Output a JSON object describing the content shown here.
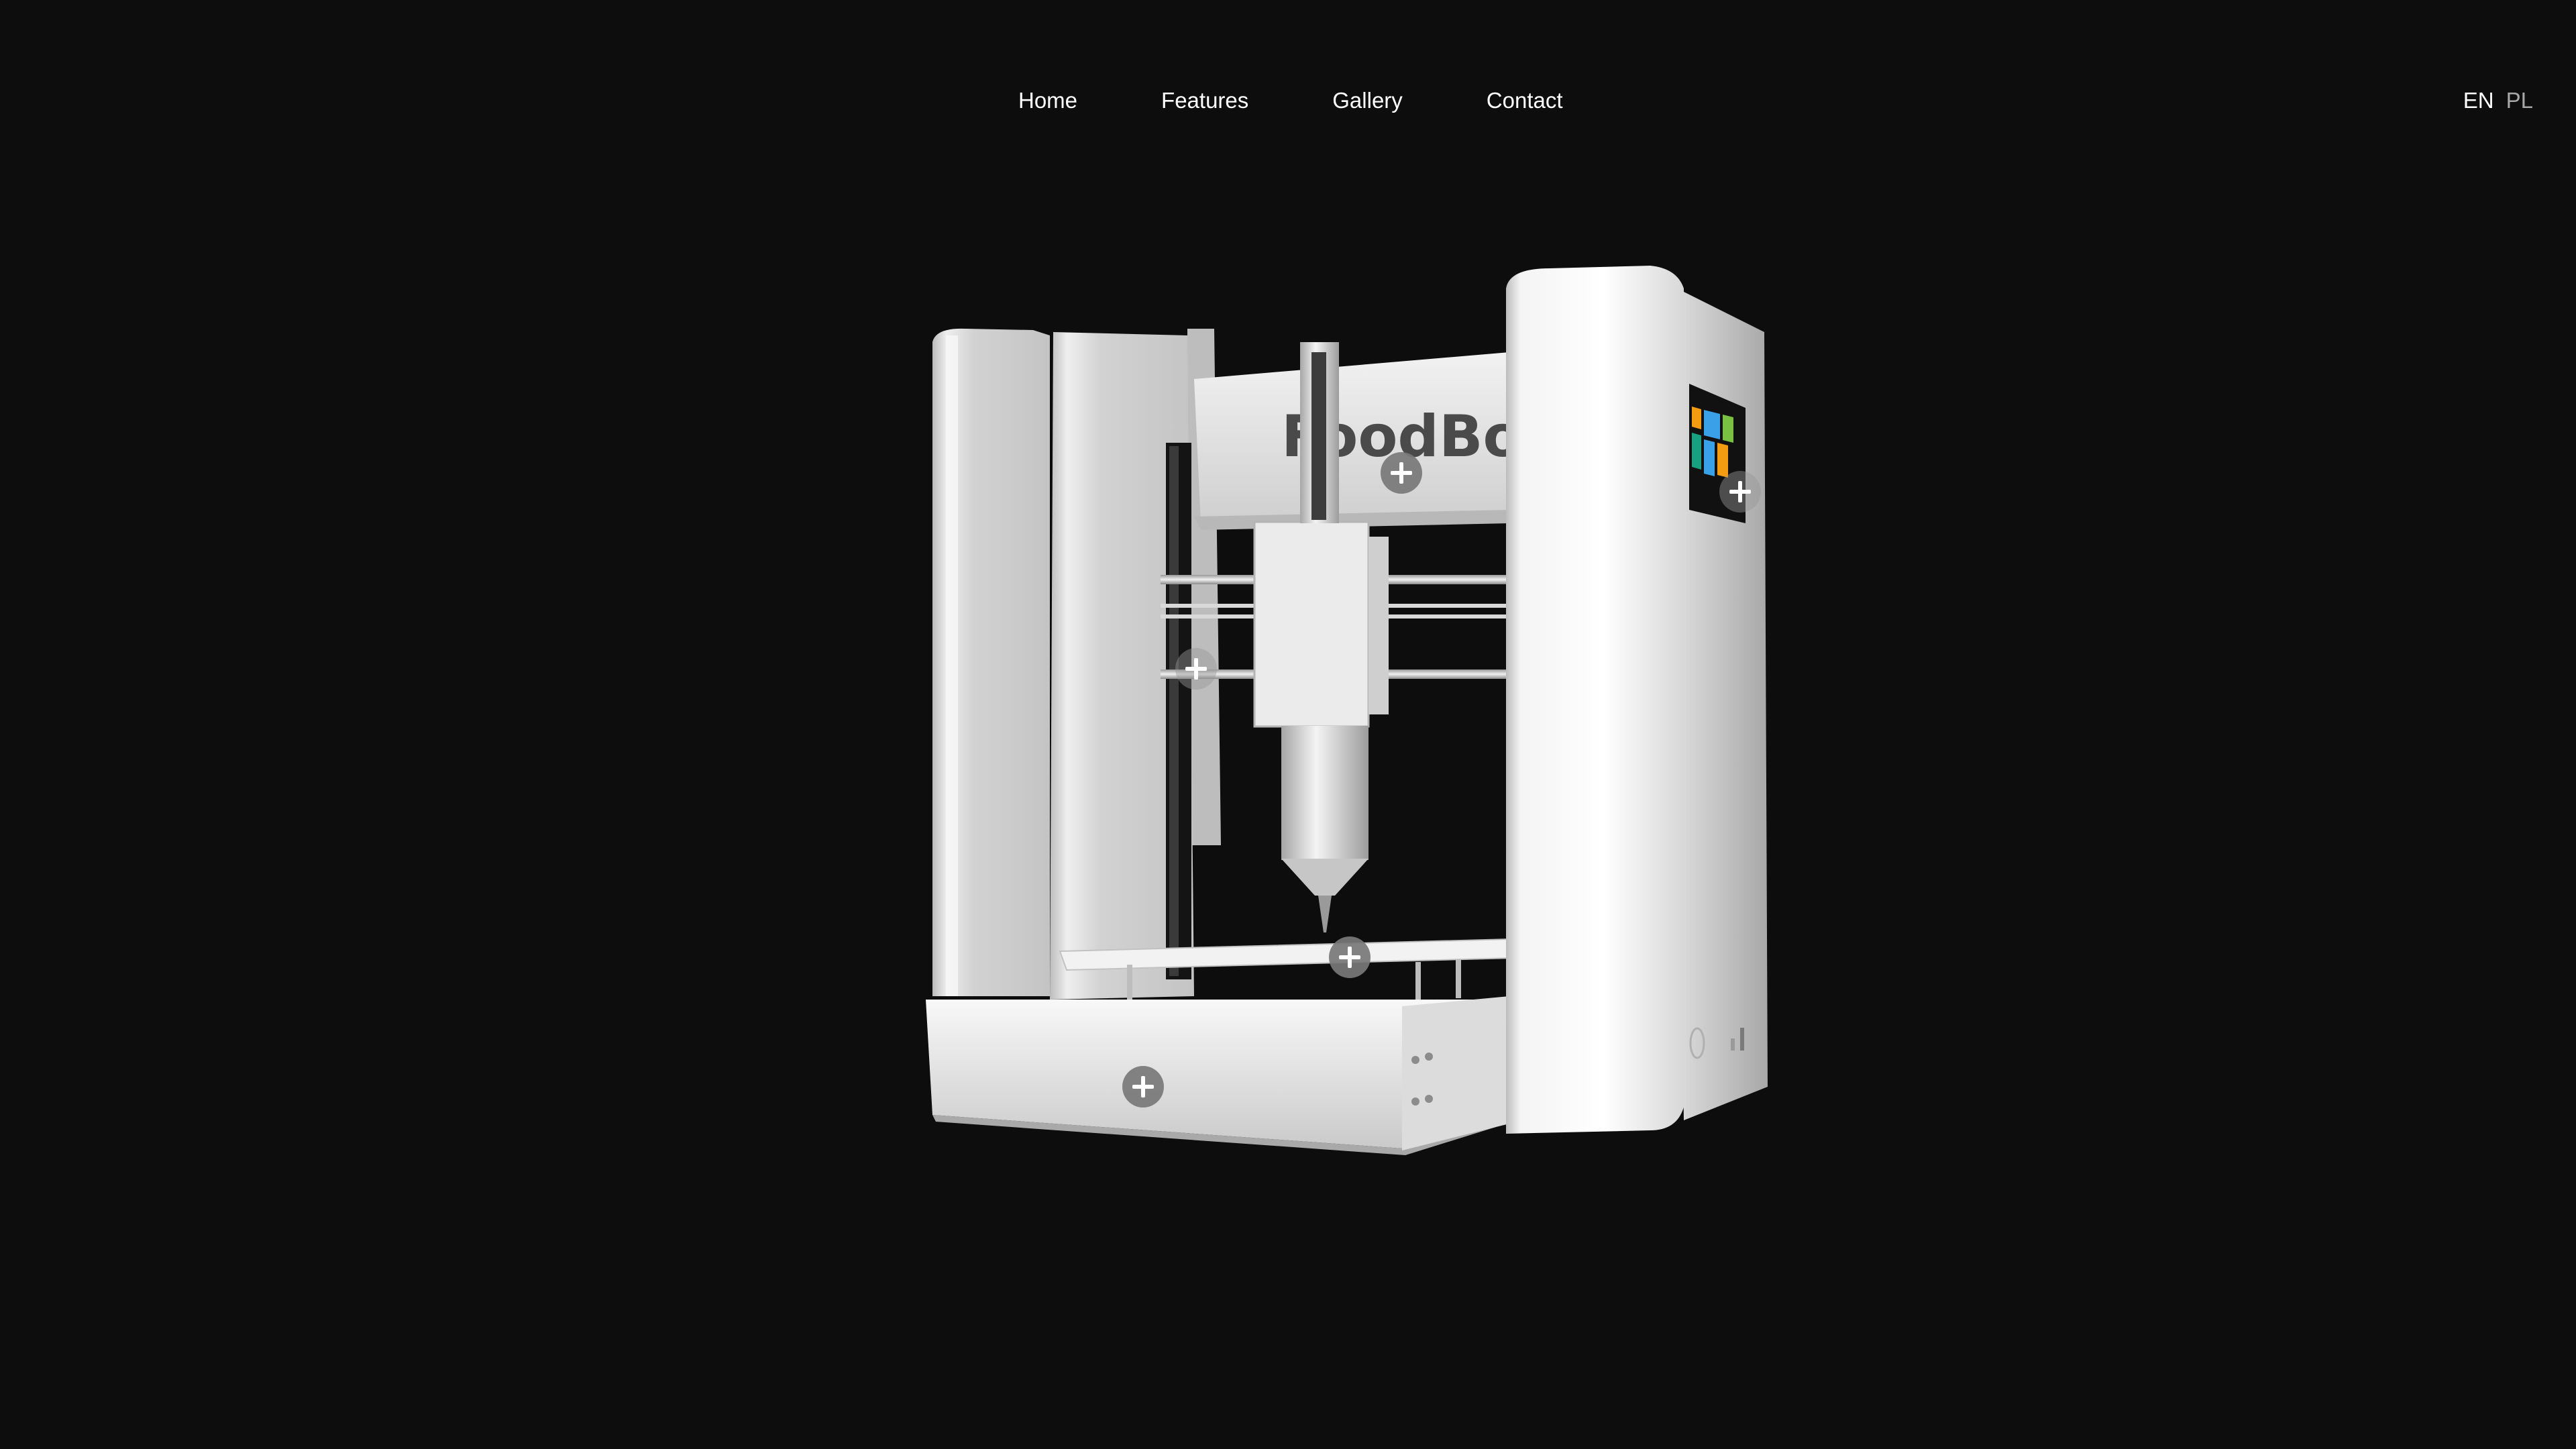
{
  "nav": {
    "items": [
      {
        "label": "Home"
      },
      {
        "label": "Features"
      },
      {
        "label": "Gallery"
      },
      {
        "label": "Contact"
      }
    ]
  },
  "language": {
    "active": "EN",
    "other": "PL"
  },
  "product": {
    "brand_text": "FoodBot",
    "hotspots": [
      {
        "name": "hotspot-top-bar"
      },
      {
        "name": "hotspot-touchscreen"
      },
      {
        "name": "hotspot-left-rail"
      },
      {
        "name": "hotspot-nozzle"
      },
      {
        "name": "hotspot-base"
      }
    ]
  },
  "colors": {
    "background": "#0d0d0d",
    "text": "#ffffff",
    "text_muted": "#a8a8a8",
    "hotspot": "#787878"
  }
}
